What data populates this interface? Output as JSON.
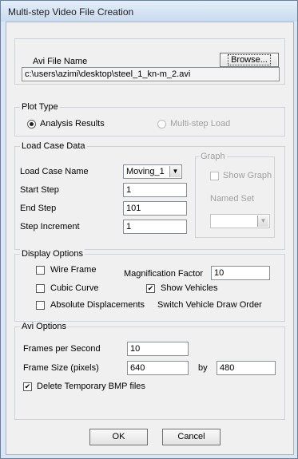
{
  "window": {
    "title": "Multi-step Video File Creation"
  },
  "avi_file": {
    "label": "Avi File Name",
    "browse_label": "Browse...",
    "path": "c:\\users\\azimi\\desktop\\steel_1_kn-m_2.avi"
  },
  "plot_type": {
    "legend": "Plot Type",
    "analysis_results": "Analysis Results",
    "multistep_load": "Multi-step Load"
  },
  "load_case": {
    "legend": "Load Case Data",
    "name_label": "Load Case Name",
    "name_value": "Moving_1",
    "start_label": "Start Step",
    "start_value": "1",
    "end_label": "End Step",
    "end_value": "101",
    "increment_label": "Step Increment",
    "increment_value": "1",
    "graph_legend": "Graph",
    "show_graph": "Show Graph",
    "named_set": "Named Set"
  },
  "display": {
    "legend": "Display Options",
    "wire_frame": "Wire Frame",
    "magnification_label": "Magnification Factor",
    "magnification_value": "10",
    "cubic_curve": "Cubic Curve",
    "show_vehicles": "Show Vehicles",
    "absolute_displacements": "Absolute Displacements",
    "switch_order": "Switch Vehicle Draw Order"
  },
  "avi_options": {
    "legend": "Avi Options",
    "fps_label": "Frames per Second",
    "fps_value": "10",
    "frame_size_label": "Frame Size (pixels)",
    "width_value": "640",
    "by_label": "by",
    "height_value": "480",
    "delete_bmp": "Delete Temporary BMP files"
  },
  "buttons": {
    "ok": "OK",
    "cancel": "Cancel"
  },
  "checks": {
    "checked_mark": "✔",
    "combo_arrow": "▼"
  }
}
